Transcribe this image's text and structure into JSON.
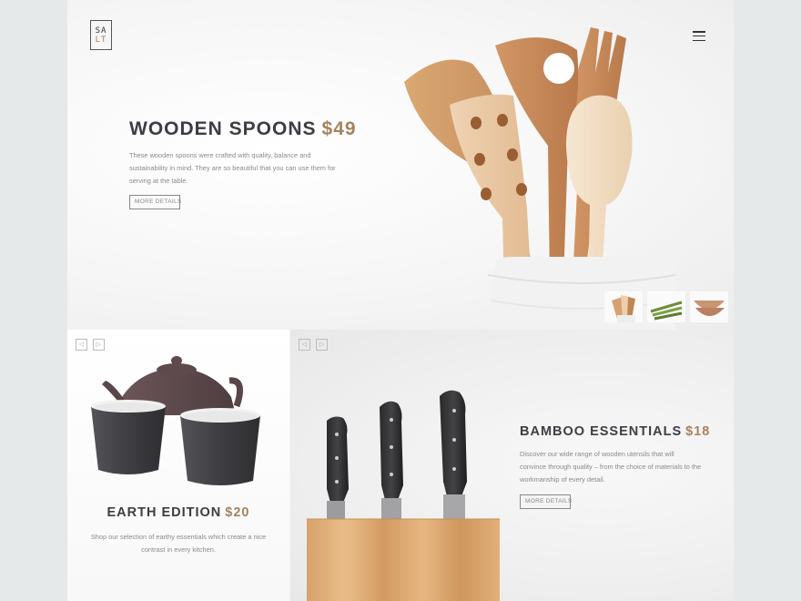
{
  "brand": {
    "logo_line1": "SA",
    "logo_line2": "LT"
  },
  "header": {
    "menu_icon": "hamburger-menu-icon"
  },
  "hero": {
    "title": "WOODEN SPOONS",
    "price": "$49",
    "description": "These wooden spoons were crafted with quality, balance and sustainability in mind. They are so beautiful that you can use them for serving at the table.",
    "button_label": "MORE DETAILS",
    "thumbnails": [
      "wooden-spoons-thumb",
      "asparagus-thumb",
      "wooden-bowls-thumb"
    ]
  },
  "earth": {
    "prev_arrow": "◁",
    "next_arrow": "▷",
    "title": "EARTH EDITION",
    "price": "$20",
    "description": "Shop our selection of earthy essentials which create a nice contrast in every kitchen."
  },
  "bamboo": {
    "prev_arrow": "◁",
    "next_arrow": "▷",
    "title": "BAMBOO ESSENTIALS",
    "price": "$18",
    "description": "Discover our wide range of wooden utensils that will convince through quality – from the choice of materials to the workmanship of every detail.",
    "button_label": "MORE DETAILS"
  },
  "colors": {
    "accent": "#a8825f",
    "heading": "#3d3d44",
    "body_text": "#8a8a8a",
    "background": "#e6e9ea"
  }
}
